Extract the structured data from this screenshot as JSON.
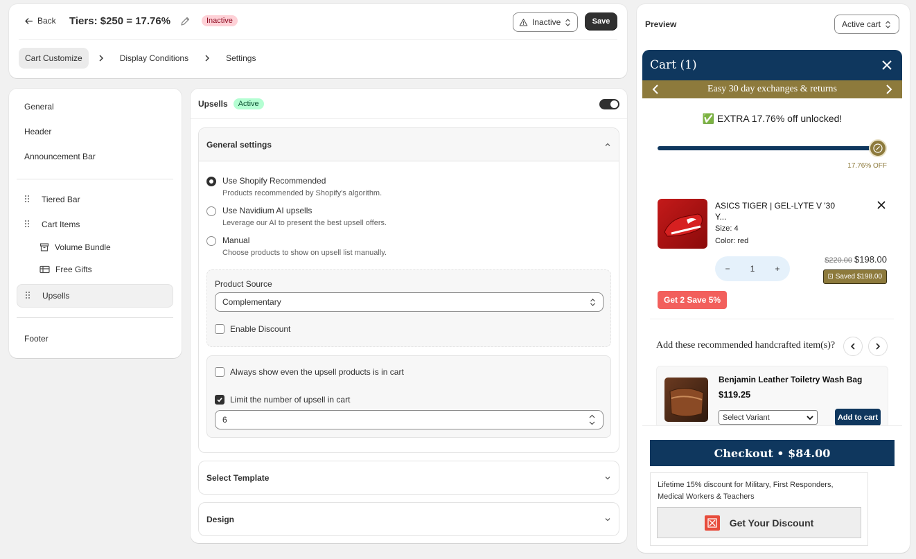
{
  "header": {
    "back_label": "Back",
    "title": "Tiers: $250 = 17.76%",
    "status_badge": "Inactive",
    "status_select": "Inactive",
    "save_label": "Save",
    "steps": [
      "Cart Customize",
      "Display Conditions",
      "Settings"
    ]
  },
  "sidebar": {
    "items_top": [
      "General",
      "Header",
      "Announcement Bar"
    ],
    "tiered_bar": "Tiered Bar",
    "cart_items": "Cart Items",
    "volume_bundle": "Volume Bundle",
    "free_gifts": "Free Gifts",
    "upsells": "Upsells",
    "footer": "Footer"
  },
  "main": {
    "title": "Upsells",
    "badge": "Active",
    "general_settings": "General settings",
    "options": [
      {
        "label": "Use Shopify Recommended",
        "help": "Products recommended by Shopify's algorithm."
      },
      {
        "label": "Use Navidium AI upsells",
        "help": "Leverage our AI to present the best upsell offers."
      },
      {
        "label": "Manual",
        "help": "Choose products to show on upsell list manually."
      }
    ],
    "product_source_label": "Product Source",
    "product_source_value": "Complementary",
    "enable_discount": "Enable Discount",
    "always_show": "Always show even the upsell products is in cart",
    "limit_label": "Limit the number of upsell in cart",
    "limit_value": "6",
    "select_template": "Select Template",
    "design": "Design"
  },
  "preview": {
    "title": "Preview",
    "select": "Active cart",
    "cart_title": "Cart (1)",
    "announcement": "Easy 30 day exchanges & returns",
    "unlocked": "✅ EXTRA 17.76% off unlocked!",
    "progress": 1.0,
    "off_label": "17.76% OFF",
    "product": {
      "name": "ASICS TIGER | GEL-LYTE V '30 Y...",
      "size": "Size: 4",
      "color": "Color: red",
      "qty": "1",
      "old_price": "$220.00",
      "price": "$198.00",
      "saved": "Saved $198.00"
    },
    "get2": "Get 2 Save 5%",
    "rec_title": "Add these recommended handcrafted item(s)?",
    "rec_product": {
      "name": "Benjamin Leather Toiletry Wash Bag",
      "price": "$119.25",
      "variant": "Select Variant",
      "add_label": "Add to cart"
    },
    "checkout": "Checkout • $84.00",
    "discount_text": "Lifetime 15% discount for Military, First Responders, Medical Workers & Teachers",
    "discount_btn": "Get Your Discount"
  },
  "colors": {
    "navy": "#0f375e",
    "gold": "#8d7a3c",
    "red": "#f25f5c"
  }
}
